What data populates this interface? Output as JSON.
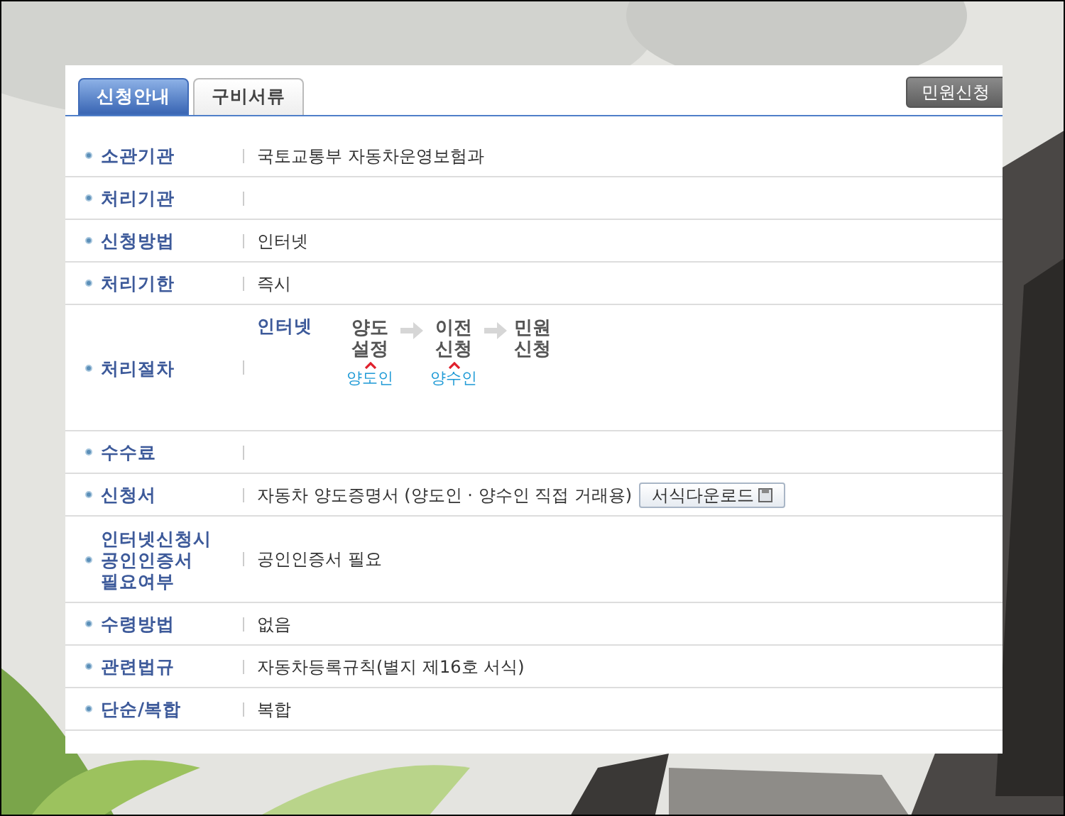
{
  "tabs": [
    {
      "label": "신청안내",
      "selected": true
    },
    {
      "label": "구비서류",
      "selected": false
    }
  ],
  "apply_button": "민원신청",
  "rows": [
    {
      "label_lines": [
        "소관기관"
      ],
      "kind": "text",
      "value": "국토교통부 자동차운영보험과"
    },
    {
      "label_lines": [
        "처리기관"
      ],
      "kind": "empty"
    },
    {
      "label_lines": [
        "신청방법"
      ],
      "kind": "text",
      "value": "인터넷"
    },
    {
      "label_lines": [
        "처리기한"
      ],
      "kind": "text",
      "value": "즉시"
    },
    {
      "label_lines": [
        "처리절차"
      ],
      "kind": "process",
      "method": "인터넷",
      "steps": [
        {
          "title_lines": [
            "양도",
            "설정"
          ],
          "actor": "양도인"
        },
        {
          "title_lines": [
            "이전",
            "신청"
          ],
          "actor": "양수인"
        },
        {
          "title_lines": [
            "민원",
            "신청"
          ]
        }
      ]
    },
    {
      "label_lines": [
        "수수료"
      ],
      "kind": "empty"
    },
    {
      "label_lines": [
        "신청서"
      ],
      "kind": "form",
      "value": "자동차 양도증명서 (양도인 · 양수인 직접 거래용)",
      "button": "서식다운로드"
    },
    {
      "label_lines": [
        "인터넷신청시",
        "공인인증서",
        "필요여부"
      ],
      "kind": "text",
      "value": "공인인증서 필요"
    },
    {
      "label_lines": [
        "수령방법"
      ],
      "kind": "text",
      "value": "없음"
    },
    {
      "label_lines": [
        "관련법규"
      ],
      "kind": "text",
      "value": "자동차등록규칙(별지 제16호 서식)"
    },
    {
      "label_lines": [
        "단순/복합"
      ],
      "kind": "text",
      "value": "복합"
    }
  ]
}
